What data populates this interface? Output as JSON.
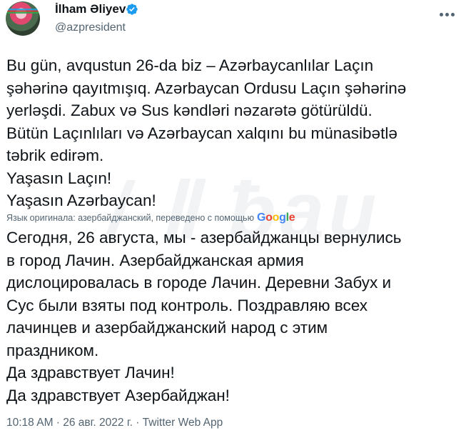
{
  "author": {
    "display_name": "İlham Əliyev",
    "handle": "@azpresident"
  },
  "tweet": {
    "text": "Bu gün, avqustun 26-da biz – Azərbaycanlılar Laçın\nşəhərinə qayıtmışıq. Azərbaycan Ordusu Laçın şəhərinə\nyerləşdi. Zabux və Sus kəndləri nəzarətə götürüldü.\nBütün Laçınlıları və Azərbaycan xalqını bu münasibətlə\ntəbrik edirəm.\nYaşasın Laçın!\nYaşasın Azərbaycan!",
    "translation_note": "Язык оригинала: азербайджанский, переведено с помощью",
    "translation_provider": "Google",
    "translated_text": "Сегодня, 26 августа, мы - азербайджанцы вернулись\nв город Лачин. Азербайджанская армия\nдислоцировалась в городе Лачин. Деревни Забух и\nСус были взяты под контроль. Поздравляю всех\nлачинцев и азербайджанский народ с этим\nпраздником.\nДа здравствует Лачин!\nДа здравствует Азербайджан!",
    "meta": "10:18 AM · 26 авг. 2022 г. · Twitter Web App"
  },
  "icons": {
    "verified": "verified-badge-icon",
    "more": "more-options-icon",
    "logo": "google-logo"
  },
  "colors": {
    "verified": "#1d9bf0",
    "secondary_text": "#536471",
    "primary_text": "#0f1419"
  }
}
